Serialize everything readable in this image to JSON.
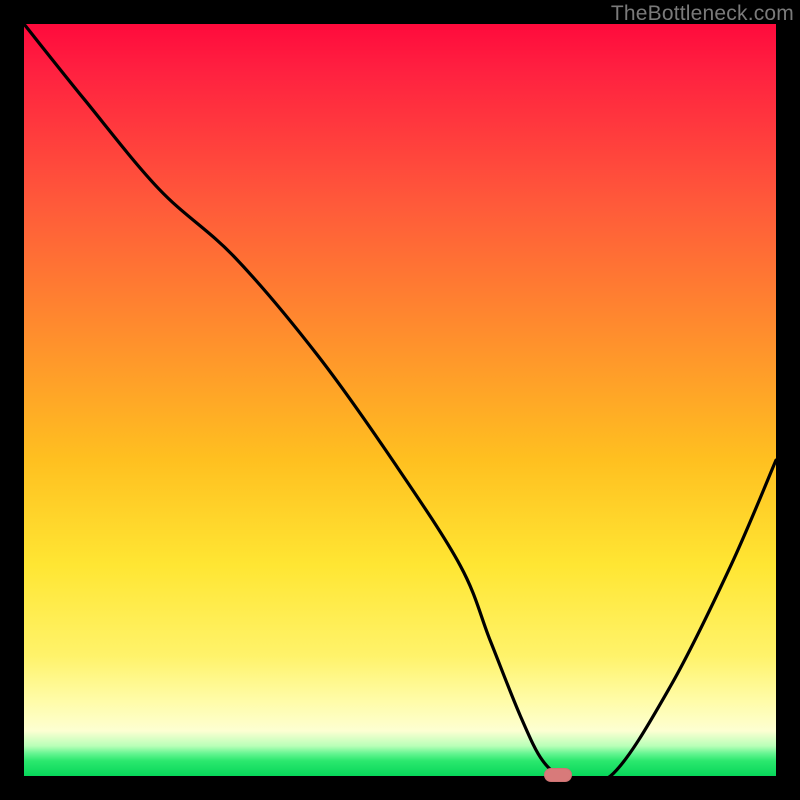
{
  "watermark": "TheBottleneck.com",
  "chart_data": {
    "type": "line",
    "title": "",
    "xlabel": "",
    "ylabel": "",
    "xlim": [
      0,
      100
    ],
    "ylim": [
      0,
      100
    ],
    "grid": false,
    "legend": false,
    "series": [
      {
        "name": "bottleneck-curve",
        "x": [
          0,
          8,
          18,
          28,
          39,
          49,
          58,
          62,
          66,
          69,
          72,
          78,
          86,
          94,
          100
        ],
        "y": [
          100,
          90,
          78,
          69,
          56,
          42,
          28,
          18,
          8,
          2,
          0,
          0,
          12,
          28,
          42
        ]
      }
    ],
    "marker": {
      "x": 71,
      "y": 0,
      "color": "#d87a7a"
    },
    "background_gradient": {
      "top": "#ff0a3c",
      "mid": "#ffd633",
      "bottom": "#07d65a"
    }
  },
  "layout": {
    "image_size": 800,
    "plot_inset": 24
  }
}
